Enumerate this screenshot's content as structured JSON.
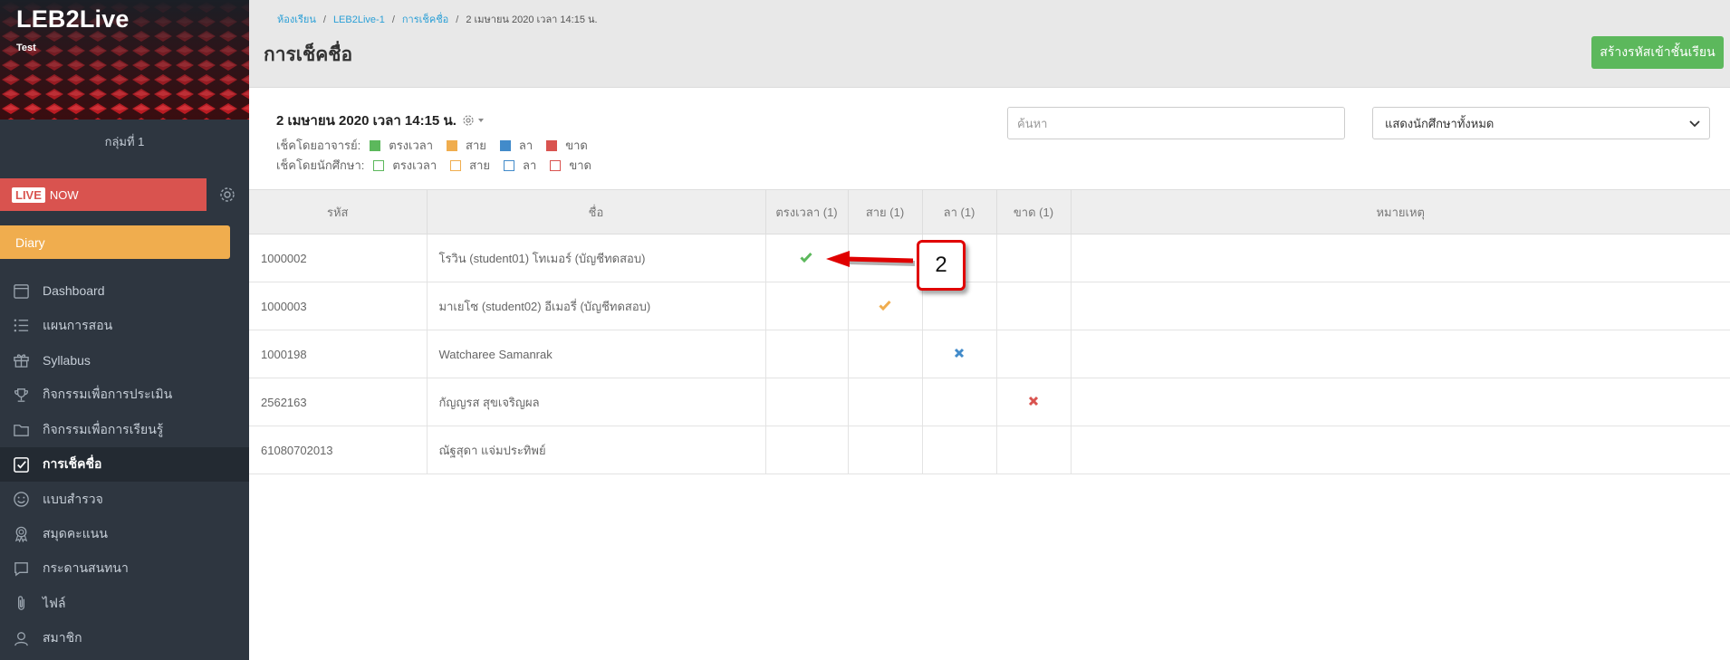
{
  "sidebar": {
    "brand": "LEB2Live",
    "brand_sub": "Test",
    "group": "กลุ่มที่ 1",
    "live_tag": "LIVE",
    "live_label": "NOW",
    "diary_label": "Diary",
    "items": [
      {
        "label": "Dashboard",
        "icon": "calendar-icon"
      },
      {
        "label": "แผนการสอน",
        "icon": "list-icon"
      },
      {
        "label": "Syllabus",
        "icon": "gift-icon"
      },
      {
        "label": "กิจกรรมเพื่อการประเมิน",
        "icon": "trophy-icon"
      },
      {
        "label": "กิจกรรมเพื่อการเรียนรู้",
        "icon": "folder-icon"
      },
      {
        "label": "การเช็คชื่อ",
        "icon": "checkbox-icon"
      },
      {
        "label": "แบบสำรวจ",
        "icon": "smiley-icon"
      },
      {
        "label": "สมุดคะแนน",
        "icon": "award-icon"
      },
      {
        "label": "กระดานสนทนา",
        "icon": "chat-icon"
      },
      {
        "label": "ไฟล์",
        "icon": "paperclip-icon"
      },
      {
        "label": "สมาชิก",
        "icon": "user-icon"
      }
    ]
  },
  "header": {
    "breadcrumb": [
      "ห้องเรียน",
      "LEB2Live-1",
      "การเช็คชื่อ",
      "2 เมษายน 2020 เวลา 14:15 น."
    ],
    "title": "การเช็คชื่อ",
    "create_button": "สร้างรหัสเข้าชั้นเรียน"
  },
  "session": {
    "title": "2 เมษายน 2020 เวลา 14:15 น."
  },
  "legend": {
    "teacher_label": "เช็คโดยอาจารย์:",
    "student_label": "เช็คโดยนักศึกษา:",
    "ontime": "ตรงเวลา",
    "late": "สาย",
    "leave": "ลา",
    "absent": "ขาด",
    "colors": {
      "ontime": "#5cb85c",
      "late": "#f0ad4e",
      "leave": "#428bca",
      "absent": "#d9534f"
    }
  },
  "search": {
    "placeholder": "ค้นหา"
  },
  "filter": {
    "selected": "แสดงนักศึกษาทั้งหมด"
  },
  "table": {
    "headers": [
      "รหัส",
      "ชื่อ",
      "ตรงเวลา (1)",
      "สาย (1)",
      "ลา (1)",
      "ขาด (1)",
      "หมายเหตุ"
    ],
    "rows": [
      {
        "id": "1000002",
        "name": "โรวิน (student01) โทเมอร์ (บัญชีทดสอบ)",
        "status": "ontime"
      },
      {
        "id": "1000003",
        "name": "มาเยโซ (student02) อีเมอรี่ (บัญชีทดสอบ)",
        "status": "late"
      },
      {
        "id": "1000198",
        "name": "Watcharee Samanrak",
        "status": "leave"
      },
      {
        "id": "2562163",
        "name": "กัญญรส สุขเจริญผล",
        "status": "absent"
      },
      {
        "id": "61080702013",
        "name": "ณัฐสุดา แจ่มประทิพย์",
        "status": ""
      }
    ]
  },
  "callout": {
    "number": "2"
  }
}
